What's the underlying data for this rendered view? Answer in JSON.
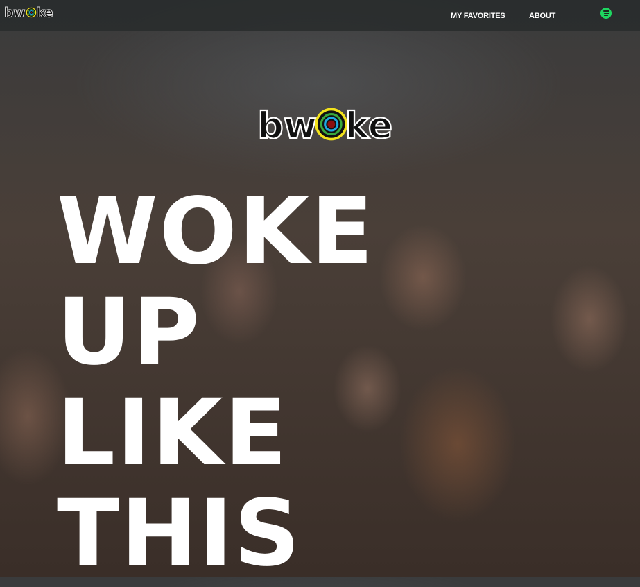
{
  "brand": {
    "logo_text": "bwoke",
    "ring_colors": [
      "#f3e21b",
      "#3aa83c",
      "#1fa8e0",
      "#8b1010"
    ]
  },
  "nav": {
    "items": [
      {
        "label": "MY FAVORITES"
      },
      {
        "label": "ABOUT"
      }
    ],
    "spotify_icon": "spotify-icon",
    "spotify_color": "#1ed760"
  },
  "hero": {
    "lines": [
      "WOKE",
      "UP",
      "LIKE",
      "THIS"
    ]
  }
}
